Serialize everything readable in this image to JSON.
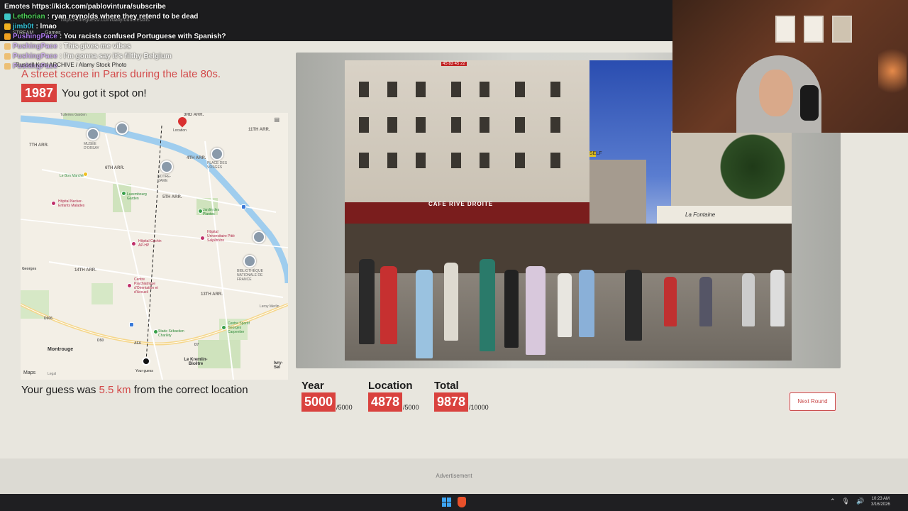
{
  "browser": {
    "url": "https://timeguessr.com/dailyroundresults",
    "tabs": [
      "STREAM",
      "Games"
    ]
  },
  "chat": [
    {
      "user": "",
      "message": "Emotes https://kick.com/pablovintura/subscribe",
      "user_color": "#ffffff",
      "badge_color": "",
      "faded": false
    },
    {
      "user": "Lethorian",
      "message": ": ryan reynolds where they retend to be dead",
      "user_color": "#4fd15a",
      "badge_color": "#3ec7c7",
      "faded": false
    },
    {
      "user": "jimb0t",
      "message": ": lmao",
      "user_color": "#36c2d8",
      "badge_color": "#f0b020",
      "faded": false
    },
    {
      "user": "PushingPace",
      "message": ": You racists confused Portuguese with Spanish?",
      "user_color": "#b07cf0",
      "badge_color": "#f0a020",
      "faded": false
    },
    {
      "user": "PushingPace",
      "message": ": This gives me vibes",
      "user_color": "#b07cf0",
      "badge_color": "#f0a020",
      "faded": true
    },
    {
      "user": "PushingPace",
      "message": ": I'm gonna say it's filthy Belgium",
      "user_color": "#b07cf0",
      "badge_color": "#f0a020",
      "faded": true
    },
    {
      "user": "PushingPace",
      "message": "",
      "user_color": "#b07cf0",
      "badge_color": "#f0a020",
      "faded": true
    }
  ],
  "result": {
    "credit": "Russell Kord ARCHIVE / Alamy Stock Photo",
    "caption": "A street scene in Paris during the late 80s.",
    "year": "1987",
    "year_message": "You got it spot on!",
    "distance_prefix": "Your guess was ",
    "distance_value": "5.5 km",
    "distance_suffix": " from the correct location"
  },
  "map": {
    "labels": {
      "arr3": "3RD ARR.",
      "arr11": "11TH ARR.",
      "arr7": "7TH ARR.",
      "arr6": "6TH ARR.",
      "arr4": "4TH ARR.",
      "arr5": "5TH ARR.",
      "arr14": "14TH ARR.",
      "arr13": "13TH ARR.",
      "montrouge": "Montrouge",
      "kremlin": "Le Kremlin-Bicêtre",
      "ivry": "Ivry-Sei",
      "georges": "Georges"
    },
    "pois": {
      "tuileries": "Tuileries Garden",
      "orsay": "MUSÉE D'ORSAY",
      "notre": "NOTRE-DAME",
      "vosges": "PLACE DES VOSGES",
      "bonmarche": "Le Bon Marché",
      "luxembourg": "Luxembourg Garden",
      "plantes": "Jardin des Plantes",
      "necker": "Hôpital Necker-Enfants Malades",
      "cochin": "Hôpital Cochin AP-HP",
      "salpetriere": "Hôpital Universitaire Pitié Salpêtrière",
      "bnf": "BIBLIOTHÈQUE NATIONALE DE FRANCE",
      "stpsy": "Centre Psychiatrique d'Orientation et d'Accueil",
      "charlety": "Stade Sébastien Charléty",
      "carpentier": "Centre Sportif Georges Carpentier",
      "leroy": "Leroy Merlin"
    },
    "road_labels": [
      "D906",
      "D50",
      "A6A",
      "D7"
    ],
    "location_label": "Location",
    "guess_label": "Your guess",
    "logo": "Maps",
    "legal": "Legal",
    "layers_icon": "map-layers-icon"
  },
  "photo": {
    "sign_left": "CAFE RIVE DROITE",
    "sign_left2": "CAFE RIVE DROITE",
    "sign_top": "45 83 45 22",
    "sign_selfe": "SELF",
    "sign_right": "La Fontaine"
  },
  "scores": [
    {
      "label": "Year",
      "value": "5000",
      "max": "/5000"
    },
    {
      "label": "Location",
      "value": "4878",
      "max": "/5000"
    },
    {
      "label": "Total",
      "value": "9878",
      "max": "/10000"
    }
  ],
  "next_button": "Next Round",
  "advertisement": "Advertisement",
  "taskbar": {
    "time": "10:23 AM",
    "date": "3/16/2026"
  },
  "colors": {
    "accent": "#d9423e",
    "background": "#e8e6de"
  }
}
